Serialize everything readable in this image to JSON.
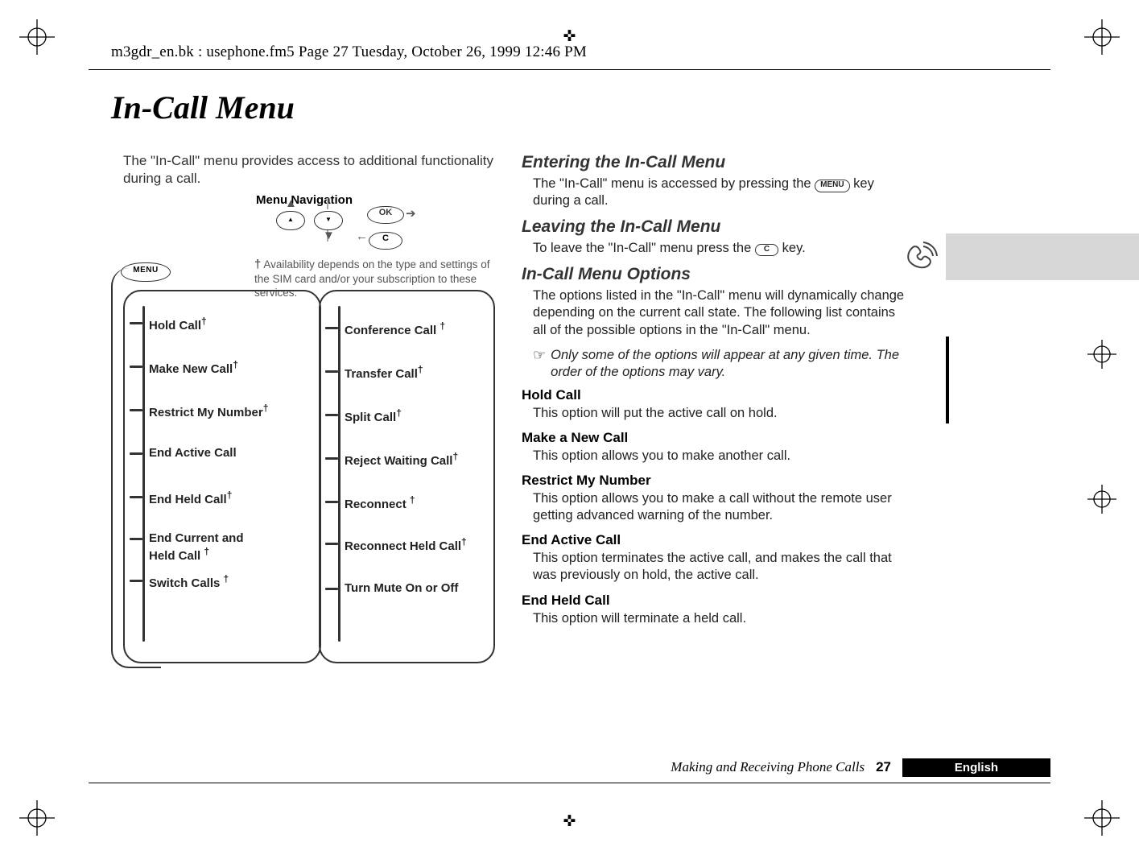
{
  "header_path": "m3gdr_en.bk : usephone.fm5  Page 27  Tuesday, October 26, 1999  12:46 PM",
  "title": "In-Call Menu",
  "intro": "The \"In-Call\" menu provides access to additional functionality during a call.",
  "diagram": {
    "title": "Menu Navigation",
    "keys": {
      "ok": "OK",
      "c": "C",
      "menu": "MENU"
    },
    "footnote_dag": "†",
    "footnote": "Availability depends on the type and settings of the SIM card and/or your subscription to these services.",
    "left_items": [
      "Hold Call",
      "Make New Call",
      "Restrict My Number",
      "End Active Call",
      "End Held Call",
      "End Current and\nHeld Call",
      "Switch Calls"
    ],
    "left_dag": [
      true,
      true,
      true,
      false,
      true,
      true,
      true
    ],
    "right_items": [
      "Conference Call",
      "Transfer Call",
      "Split Call",
      "Reject Waiting Call",
      "Reconnect",
      "Reconnect Held Call",
      "Turn Mute On or Off"
    ],
    "right_dag": [
      true,
      true,
      true,
      true,
      true,
      true,
      false
    ]
  },
  "sections": {
    "enter_head": "Entering the In-Call Menu",
    "enter_body_a": "The \"In-Call\" menu is accessed by pressing the ",
    "enter_body_b": " key during a call.",
    "menu_cap": "MENU",
    "leave_head": "Leaving the In-Call Menu",
    "leave_body_a": "To leave the \"In-Call\" menu press the ",
    "leave_body_b": " key.",
    "c_cap": "C",
    "opts_head": "In-Call Menu Options",
    "opts_body": "The options listed in the \"In-Call\" menu will dynamically change depending on the current call state. The following list contains all of the possible options in the \"In-Call\" menu.",
    "note": "Only some of the options will appear at any given time. The order of the options may vary.",
    "hold_head": "Hold Call",
    "hold_body": "This option will put the active call on hold.",
    "make_head": "Make a New Call",
    "make_body": "This option allows you to make another call.",
    "restrict_head": "Restrict My Number",
    "restrict_body": "This option allows you to make a call without the remote user getting advanced warning of the number.",
    "endact_head": "End Active Call",
    "endact_body": "This option terminates the active call, and makes the call that was previously on hold, the active call.",
    "endheld_head": "End Held Call",
    "endheld_body": "This option will terminate a held call."
  },
  "footer": {
    "section": "Making and Receiving Phone Calls",
    "page": "27",
    "lang": "English"
  }
}
